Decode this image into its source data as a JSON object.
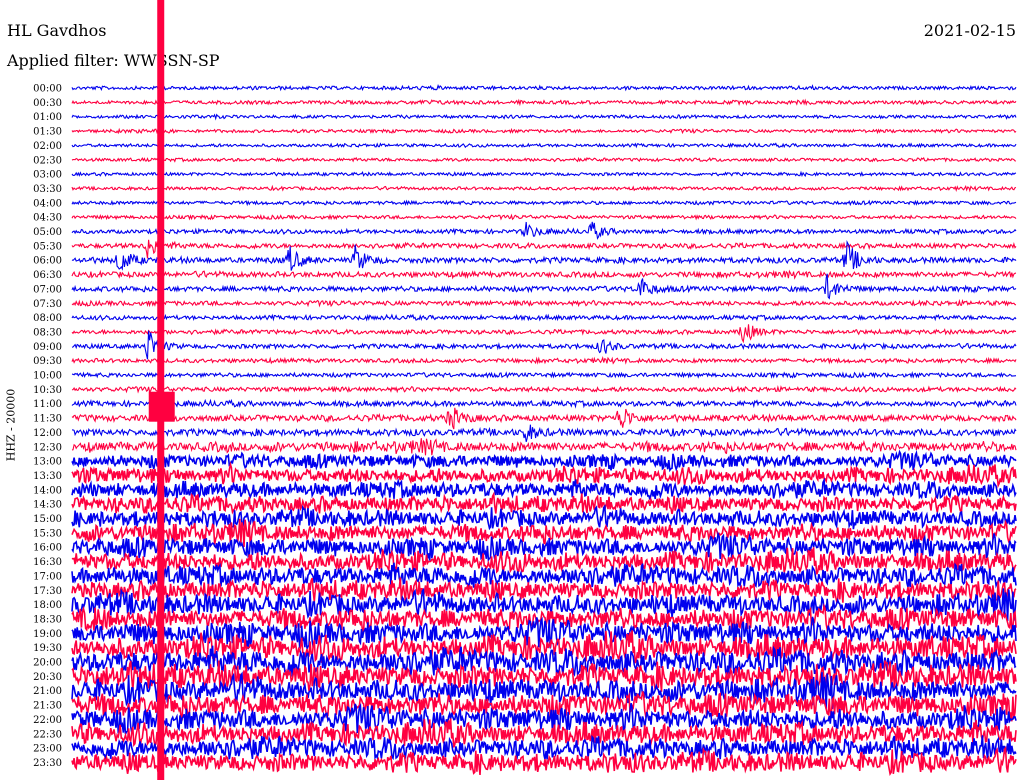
{
  "header": {
    "station": "HL Gavdhos",
    "date": "2021-02-15",
    "filter": "Applied filter: WWSSN-SP"
  },
  "chart_data": {
    "type": "seismogram-helicorder",
    "ylabel": "HHZ - 20000",
    "row_labels": [
      "00:00",
      "00:30",
      "01:00",
      "01:30",
      "02:00",
      "02:30",
      "03:00",
      "03:30",
      "04:00",
      "04:30",
      "05:00",
      "05:30",
      "06:00",
      "06:30",
      "07:00",
      "07:30",
      "08:00",
      "08:30",
      "09:00",
      "09:30",
      "10:00",
      "10:30",
      "11:00",
      "11:30",
      "12:00",
      "12:30",
      "13:00",
      "13:30",
      "14:00",
      "14:30",
      "15:00",
      "15:30",
      "16:00",
      "16:30",
      "17:00",
      "17:30",
      "18:00",
      "18:30",
      "19:00",
      "19:30",
      "20:00",
      "20:30",
      "21:00",
      "21:30",
      "22:00",
      "22:30",
      "23:00",
      "23:30"
    ],
    "series_colors": [
      "#0000ee",
      "#ff0040"
    ],
    "color_pattern": "alternating rows starting blue",
    "relative_noise_level": [
      1,
      1,
      0.9,
      0.9,
      0.9,
      0.9,
      0.9,
      0.9,
      1,
      1,
      1.2,
      1.4,
      1.6,
      1.6,
      1.5,
      1.3,
      1.2,
      1.2,
      1.3,
      1.2,
      1.2,
      1.3,
      1.5,
      1.8,
      1.9,
      2.3,
      2.8,
      3.2,
      3.3,
      3.5,
      3.6,
      3.8,
      4,
      4.1,
      4.2,
      4.2,
      4.4,
      4.6,
      4.8,
      5,
      5.2,
      5.2,
      5,
      4.9,
      4.7,
      4.4,
      4.2,
      4.2
    ],
    "events": [
      {
        "row": "05:30",
        "time_frac": 0.08,
        "amplitude": 3
      },
      {
        "row": "06:00",
        "time_frac": 0.05,
        "amplitude": 3
      },
      {
        "row": "06:00",
        "time_frac": 0.23,
        "amplitude": 3
      },
      {
        "row": "06:00",
        "time_frac": 0.3,
        "amplitude": 3
      },
      {
        "row": "06:00",
        "time_frac": 0.82,
        "amplitude": 4
      },
      {
        "row": "05:00",
        "time_frac": 0.48,
        "amplitude": 2
      },
      {
        "row": "05:00",
        "time_frac": 0.55,
        "amplitude": 2
      },
      {
        "row": "07:00",
        "time_frac": 0.6,
        "amplitude": 3
      },
      {
        "row": "07:00",
        "time_frac": 0.8,
        "amplitude": 3
      },
      {
        "row": "08:30",
        "time_frac": 0.71,
        "amplitude": 3
      },
      {
        "row": "09:00",
        "time_frac": 0.08,
        "amplitude": 4
      },
      {
        "row": "09:00",
        "time_frac": 0.56,
        "amplitude": 2
      },
      {
        "row": "11:30",
        "time_frac": 0.4,
        "amplitude": 3
      },
      {
        "row": "11:30",
        "time_frac": 0.58,
        "amplitude": 3
      },
      {
        "row": "12:00",
        "time_frac": 0.48,
        "amplitude": 2
      }
    ],
    "saturated_trace": {
      "time_frac": 0.094,
      "rows": [
        "00:00",
        "23:30"
      ]
    }
  }
}
